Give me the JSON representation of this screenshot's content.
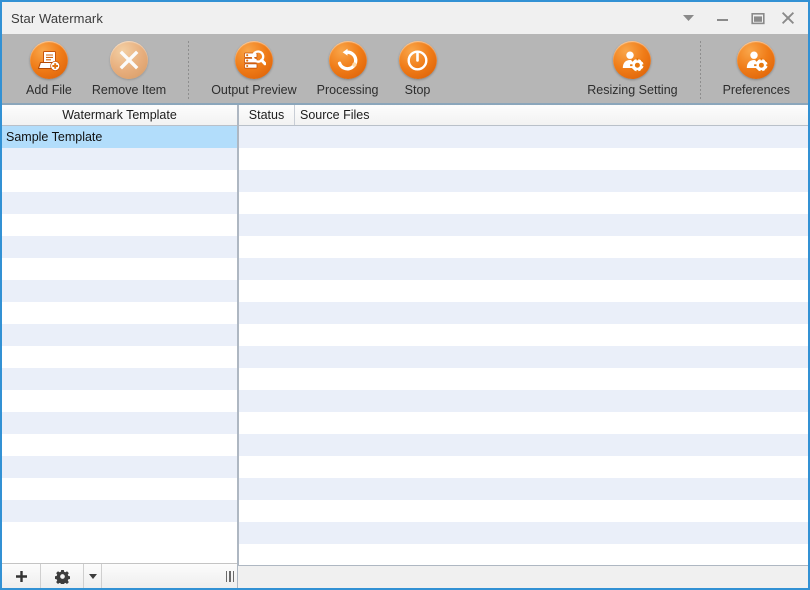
{
  "window": {
    "title": "Star Watermark",
    "accent_border": "#3291d4",
    "titlebar_bg": "#f0f0f0",
    "toolbar_bg": "#b6b6b6",
    "brand_orange": "#f07c18",
    "selection_blue": "#b2ddfb",
    "stripe_blue": "#eaeff9"
  },
  "window_controls": [
    {
      "name": "chevron-down-icon",
      "label": ""
    },
    {
      "name": "minimize-button",
      "label": ""
    },
    {
      "name": "maximize-button",
      "label": ""
    },
    {
      "name": "close-button",
      "label": ""
    }
  ],
  "toolbar": {
    "left_items": [
      {
        "label": "Add File",
        "icon": "add-file-icon",
        "enabled": true
      },
      {
        "label": "Remove Item",
        "icon": "remove-item-icon",
        "enabled": false
      }
    ],
    "middle_items": [
      {
        "label": "Output Preview",
        "icon": "output-preview-icon",
        "enabled": true
      },
      {
        "label": "Processing",
        "icon": "processing-icon",
        "enabled": true
      },
      {
        "label": "Stop",
        "icon": "stop-icon",
        "enabled": true
      }
    ],
    "right_items": [
      {
        "label": "Resizing Setting",
        "icon": "resizing-setting-icon",
        "enabled": true
      },
      {
        "label": "Preferences",
        "icon": "preferences-icon",
        "enabled": true
      }
    ]
  },
  "left_panel": {
    "header": "Watermark Template",
    "templates": [
      {
        "name": "Sample Template",
        "selected": true
      }
    ],
    "footer": {
      "add_label": "+",
      "gear_label": "",
      "caret_label": ""
    }
  },
  "right_panel": {
    "columns": [
      {
        "key": "status",
        "label": "Status"
      },
      {
        "key": "source",
        "label": "Source Files"
      }
    ],
    "rows": []
  }
}
